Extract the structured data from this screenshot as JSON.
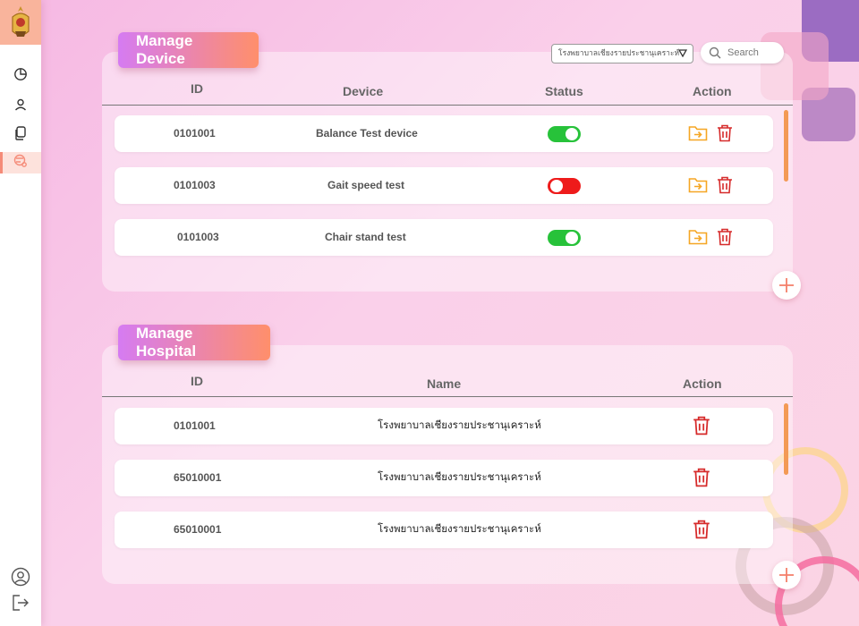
{
  "colors": {
    "accent": "#f58b78",
    "toggle_on": "#27c23a",
    "toggle_off": "#ee1b1b",
    "edit_icon": "#f5a623",
    "delete_icon": "#d62b2b"
  },
  "sidebar": {
    "logo": "hospital-crest-icon",
    "items": [
      {
        "icon": "pie-chart-icon",
        "active": false
      },
      {
        "icon": "user-icon",
        "active": false
      },
      {
        "icon": "documents-icon",
        "active": false
      },
      {
        "icon": "device-settings-icon",
        "active": true
      }
    ],
    "bottom": [
      {
        "icon": "profile-icon"
      },
      {
        "icon": "logout-icon"
      }
    ]
  },
  "device_section": {
    "title": "Manage Device",
    "hospital_select": {
      "value": "โรงพยาบาลเชียงรายประชานุเคราะห์"
    },
    "search": {
      "placeholder": "Search"
    },
    "headers": {
      "id": "ID",
      "device": "Device",
      "status": "Status",
      "action": "Action"
    },
    "rows": [
      {
        "id": "0101001",
        "device": "Balance Test device",
        "status": "on"
      },
      {
        "id": "0101003",
        "device": "Gait speed test",
        "status": "off"
      },
      {
        "id": "0101003",
        "device": "Chair stand test",
        "status": "on"
      }
    ]
  },
  "hospital_section": {
    "title": "Manage Hospital",
    "headers": {
      "id": "ID",
      "name": "Name",
      "action": "Action"
    },
    "rows": [
      {
        "id": "0101001",
        "name": "โรงพยาบาลเชียงรายประชานุเคราะห์"
      },
      {
        "id": "65010001",
        "name": "โรงพยาบาลเชียงรายประชานุเคราะห์"
      },
      {
        "id": "65010001",
        "name": "โรงพยาบาลเชียงรายประชานุเคราะห์"
      }
    ]
  }
}
